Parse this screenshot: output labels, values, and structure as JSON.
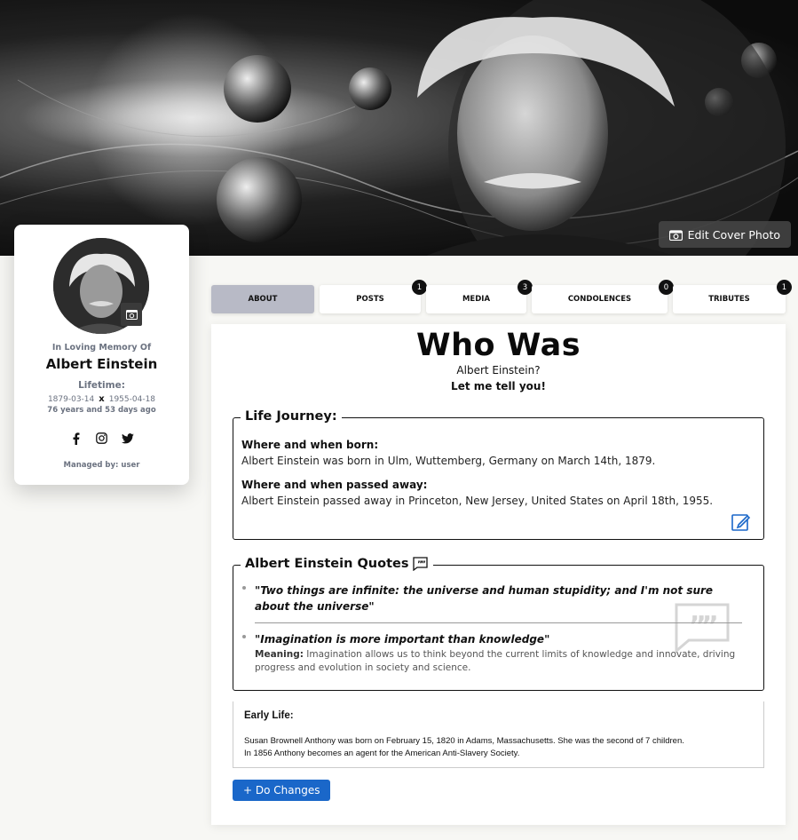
{
  "cover": {
    "edit_label": "Edit Cover Photo"
  },
  "profile": {
    "memory_label": "In Loving Memory Of",
    "name": "Albert Einstein",
    "lifetime_label": "Lifetime:",
    "birth": "1879-03-14",
    "separator": "x",
    "death": "1955-04-18",
    "age": "76 years and 53 days ago",
    "social_icons": [
      "facebook-icon",
      "instagram-icon",
      "twitter-icon"
    ],
    "managed_by": "Managed by: user"
  },
  "tabs": [
    {
      "label": "ABOUT",
      "active": true
    },
    {
      "label": "POSTS",
      "badge": "1"
    },
    {
      "label": "MEDIA",
      "badge": "3"
    },
    {
      "label": "CONDOLENCES",
      "badge": "0"
    },
    {
      "label": "TRIBUTES",
      "badge": "1"
    }
  ],
  "about": {
    "title": "Who Was",
    "subject": "Albert Einstein?",
    "tagline": "Let me tell you!",
    "journey": {
      "legend": "Life Journey:",
      "born_label": "Where and when born:",
      "born_text": "Albert Einstein was born in Ulm, Wuttemberg, Germany on March 14th, 1879.",
      "passed_label": "Where and when passed away:",
      "passed_text": "Albert Einstein passed away in Princeton, New Jersey, United States on April 18th, 1955."
    },
    "quotes": {
      "legend": "Albert Einstein Quotes",
      "items": [
        {
          "text": "\"Two things are infinite: the universe and human stupidity; and I'm not sure about the universe\""
        },
        {
          "text": "\"Imagination is more important than knowledge\"",
          "meaning_label": "Meaning:",
          "meaning": "Imagination allows us to think beyond the current limits of knowledge and innovate, driving progress and evolution in society and science."
        }
      ]
    },
    "early_life": {
      "title": "Early Life:",
      "line1": "Susan Brownell Anthony was born on February 15, 1820 in Adams, Massachusetts. She was the second of 7 children.",
      "line2": "In 1856 Anthony becomes an agent for the American Anti-Slavery Society."
    },
    "do_changes_label": "+ Do Changes"
  },
  "colors": {
    "accent_button": "#1a67c9",
    "active_tab": "#b8bac6",
    "badge": "#111111"
  }
}
